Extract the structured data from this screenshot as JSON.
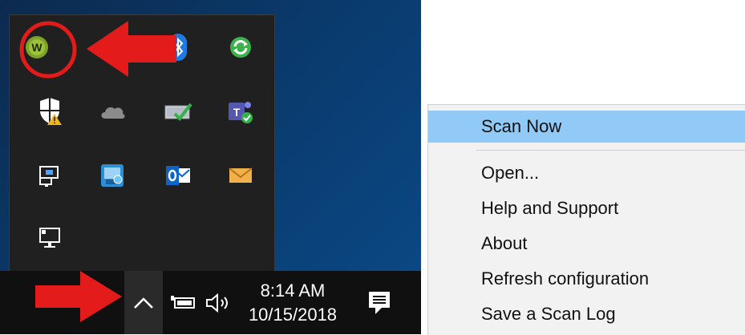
{
  "tray": {
    "icons": [
      {
        "name": "webroot-icon"
      },
      {
        "name": "bluetooth-icon"
      },
      {
        "name": "sync-icon"
      },
      {
        "name": "windows-defender-warning-icon"
      },
      {
        "name": "onedrive-icon"
      },
      {
        "name": "power-manager-icon"
      },
      {
        "name": "teams-icon"
      },
      {
        "name": "remote-desktop-icon"
      },
      {
        "name": "network-connection-icon"
      },
      {
        "name": "outlook-icon"
      },
      {
        "name": "mail-icon"
      },
      {
        "name": "display-icon"
      }
    ]
  },
  "taskbar": {
    "time": "8:14 AM",
    "date": "10/15/2018"
  },
  "menu": {
    "items": [
      {
        "label": "Scan Now",
        "highlighted": true
      },
      {
        "label": "Open..."
      },
      {
        "label": "Help and Support"
      },
      {
        "label": "About"
      },
      {
        "label": "Refresh configuration"
      },
      {
        "label": "Save a Scan Log"
      }
    ]
  },
  "annotations": {
    "arrow_color": "#e31b1b",
    "circle_color": "#e31b1b"
  }
}
